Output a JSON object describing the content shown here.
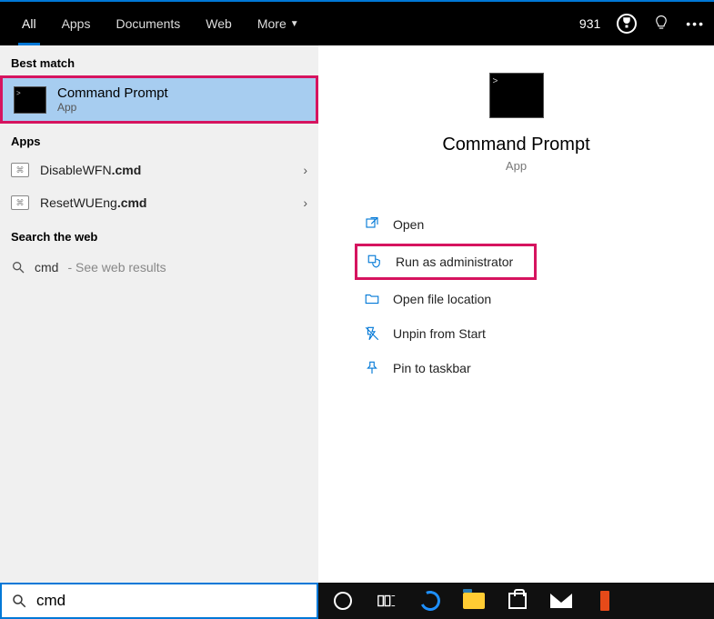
{
  "topbar": {
    "tabs": {
      "all": "All",
      "apps": "Apps",
      "documents": "Documents",
      "web": "Web",
      "more": "More"
    },
    "rewards": "931"
  },
  "sections": {
    "best_match": "Best match",
    "apps": "Apps",
    "search_web": "Search the web"
  },
  "best_match": {
    "title": "Command Prompt",
    "subtitle": "App"
  },
  "app_results": [
    {
      "name": "DisableWFN",
      "ext": ".cmd"
    },
    {
      "name": "ResetWUEng",
      "ext": ".cmd"
    }
  ],
  "web_result": {
    "query": "cmd",
    "hint": "- See web results"
  },
  "right": {
    "title": "Command Prompt",
    "subtitle": "App",
    "actions": {
      "open": "Open",
      "run_admin": "Run as administrator",
      "open_location": "Open file location",
      "unpin_start": "Unpin from Start",
      "pin_taskbar": "Pin to taskbar"
    }
  },
  "search": {
    "value": "cmd"
  }
}
